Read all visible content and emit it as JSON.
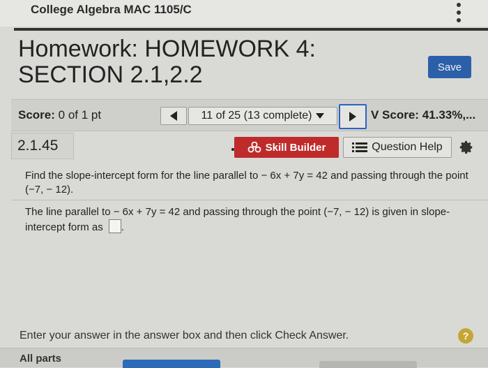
{
  "header": {
    "course_title": "College Algebra MAC 1105/C",
    "homework_title_line1": "Homework: HOMEWORK 4:",
    "homework_title_line2": "SECTION 2.1,2.2",
    "save_label": "Save"
  },
  "score_bar": {
    "score_label": "Score:",
    "score_value": "0 of 1 pt",
    "question_position": "11 of 25 (13 complete)",
    "hw_score": "V Score: 41.33%,..."
  },
  "question_row": {
    "number": "2.1.45",
    "skill_builder_label": "Skill Builder",
    "question_help_label": "Question Help"
  },
  "question": {
    "prompt": "Find the slope-intercept form for the line parallel to  − 6x + 7y = 42 and passing through the point (−7, − 12).",
    "answer_text": "The line parallel to  − 6x + 7y = 42 and passing through the point (−7, − 12) is given in slope-intercept form as",
    "answer_suffix": "."
  },
  "footer": {
    "instruction": "Enter your answer in the answer box and then click Check Answer.",
    "help_symbol": "?",
    "all_parts_label": "All parts"
  },
  "colors": {
    "save_button": "#2b5fa8",
    "skill_builder": "#bf2b2b",
    "next_highlight": "#2a62c8"
  }
}
